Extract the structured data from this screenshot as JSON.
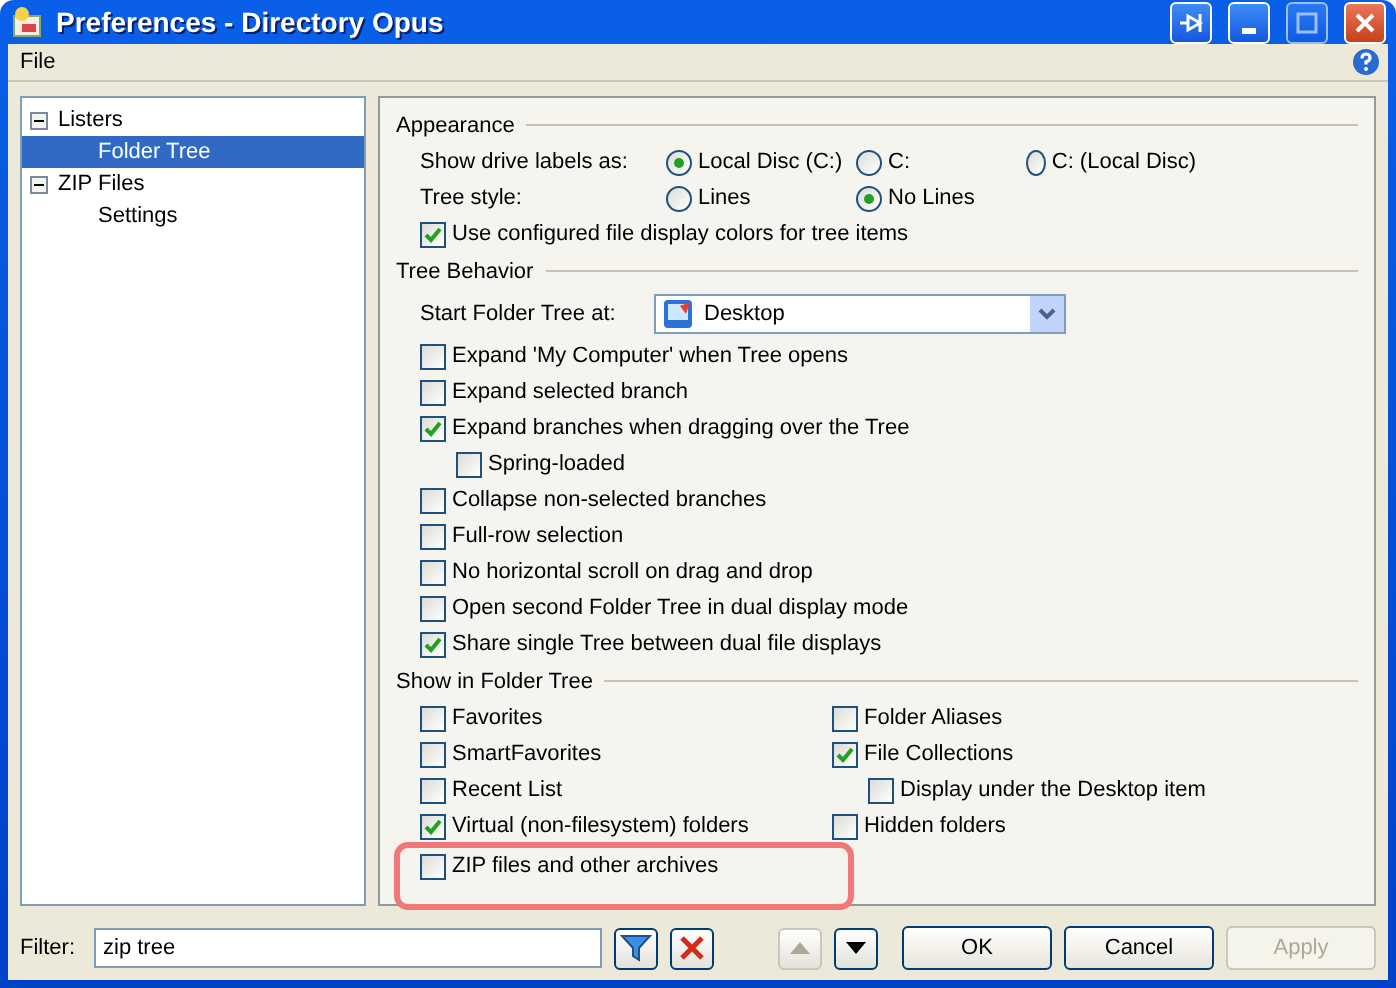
{
  "window": {
    "title": "Preferences - Directory Opus"
  },
  "menu": [
    {
      "label": "File"
    }
  ],
  "sidebar": {
    "items": [
      {
        "label": "Listers",
        "expanded": true,
        "selected": false,
        "children": [
          {
            "label": "Folder Tree",
            "selected": true
          }
        ]
      },
      {
        "label": "ZIP Files",
        "expanded": true,
        "selected": false,
        "children": [
          {
            "label": "Settings",
            "selected": false
          }
        ]
      }
    ]
  },
  "sections": [
    {
      "title": "Appearance",
      "rows": [
        {
          "kind": "radios",
          "label": "Show drive labels as:",
          "options": [
            {
              "label": "Local Disc (C:)",
              "selected": true
            },
            {
              "label": "C:",
              "selected": false
            },
            {
              "label": "C: (Local Disc)",
              "selected": false
            }
          ]
        },
        {
          "kind": "radios",
          "label": "Tree style:",
          "options": [
            {
              "label": "Lines",
              "selected": false
            },
            {
              "label": "No Lines",
              "selected": true
            }
          ]
        },
        {
          "kind": "checkbox",
          "label": "Use configured file display colors for tree items",
          "checked": true
        }
      ]
    },
    {
      "title": "Tree Behavior",
      "rows": [
        {
          "kind": "dropdown",
          "label": "Start Folder Tree at:",
          "value": "Desktop"
        },
        {
          "kind": "checkbox",
          "label": "Expand 'My Computer' when Tree opens",
          "checked": false
        },
        {
          "kind": "checkbox",
          "label": "Expand selected branch",
          "checked": false
        },
        {
          "kind": "checkbox",
          "label": "Expand branches when dragging over the Tree",
          "checked": true,
          "children": [
            {
              "label": "Spring-loaded",
              "checked": false
            }
          ]
        },
        {
          "kind": "checkbox",
          "label": "Collapse non-selected branches",
          "checked": false
        },
        {
          "kind": "checkbox",
          "label": "Full-row selection",
          "checked": false
        },
        {
          "kind": "checkbox",
          "label": "No horizontal scroll on drag and drop",
          "checked": false
        },
        {
          "kind": "checkbox",
          "label": "Open second Folder Tree in dual display mode",
          "checked": false
        },
        {
          "kind": "checkbox",
          "label": "Share single Tree between dual file displays",
          "checked": true
        }
      ]
    },
    {
      "title": "Show in Folder Tree",
      "columns": [
        [
          {
            "label": "Favorites",
            "checked": false,
            "highlighted": false
          },
          {
            "label": "SmartFavorites",
            "checked": false,
            "highlighted": false
          },
          {
            "label": "Recent List",
            "checked": false,
            "highlighted": false
          },
          {
            "label": "Virtual (non-filesystem) folders",
            "checked": true,
            "highlighted": false
          },
          {
            "label": "ZIP files and other archives",
            "checked": false,
            "highlighted": true
          }
        ],
        [
          {
            "label": "Folder Aliases",
            "checked": false,
            "highlighted": false
          },
          {
            "label": "File Collections",
            "checked": true,
            "highlighted": false,
            "children": [
              {
                "label": "Display under the Desktop item",
                "checked": false
              }
            ]
          },
          {
            "label": "Hidden folders",
            "checked": false,
            "highlighted": false
          }
        ]
      ]
    }
  ],
  "footer": {
    "filter_label": "Filter:",
    "filter_value": "zip tree",
    "nav": [
      {
        "kind": "up",
        "disabled": true
      },
      {
        "kind": "down",
        "disabled": false
      }
    ],
    "buttons": [
      {
        "label": "OK",
        "disabled": false
      },
      {
        "label": "Cancel",
        "disabled": false
      },
      {
        "label": "Apply",
        "disabled": true
      }
    ]
  }
}
